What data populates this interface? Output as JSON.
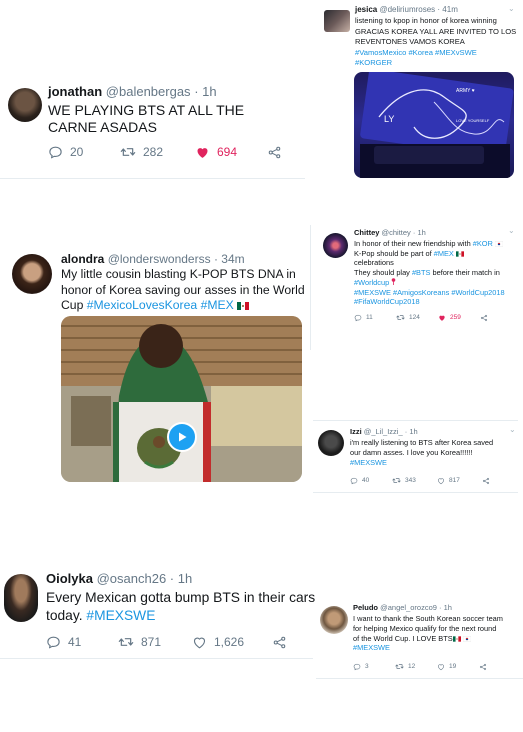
{
  "t1": {
    "name": "jonathan",
    "handle": "@balenbergas",
    "time": "· 1h",
    "text": "WE PLAYING BTS AT ALL THE CARNE ASADAS",
    "replies": "20",
    "retweets": "282",
    "likes": "694"
  },
  "t2": {
    "name": "jesica",
    "handle": "@deliriumroses",
    "time": "· 41m",
    "line1": "listening to kpop in honor of korea winning",
    "line2": "GRACIAS KOREA YALL ARE INVITED TO LOS",
    "line3": "REVENTONES VAMOS KOREA",
    "tags": "#VamosMexico #Korea #MEXvSWE",
    "tag2": "#KORGER",
    "img_text_1": "LY",
    "img_text_2": "ARMY ♥",
    "img_text_3": "LOVE YOURSELF"
  },
  "t3": {
    "name": "alondra",
    "handle": "@londerswonderss",
    "time": "· 34m",
    "line1": "My little cousin blasting K-POP BTS DNA in",
    "line2": "honor of Korea saving our asses in the World",
    "line3a": "Cup ",
    "tag1": "#MexicoLovesKorea",
    "tag2": "#MEX"
  },
  "t4": {
    "name": "Chittey",
    "handle": "@chittey",
    "time": "· 1h",
    "l1a": "In honor of their new friendship with ",
    "l1tag": "#KOR",
    "l2a": "K-Pop should be part of ",
    "l2tag": "#MEX",
    "l3": "celebrations",
    "l4a": "They should play ",
    "l4tag": "#BTS",
    "l4b": " before their match in",
    "l5": "#Worldcup",
    "l6": "#MEXSWE #AmigosKoreans #WorldCup2018",
    "l7": "#FifaWorldCup2018",
    "replies": "11",
    "retweets": "124",
    "likes": "259"
  },
  "t5": {
    "name": "Izzi",
    "handle": "@_Lil_Izzi_",
    "time": "· 1h",
    "line1": "i'm really listening to BTS after Korea saved",
    "line2": "our damn asses. I love you Korea!!!!!!",
    "tag": "#MEXSWE",
    "replies": "40",
    "retweets": "343",
    "likes": "817"
  },
  "t6": {
    "name": "Oiolyka",
    "handle": "@osanch26",
    "time": "· 1h",
    "line1": "Every Mexican gotta bump BTS in their cars",
    "line2a": "today. ",
    "tag": "#MEXSWE",
    "replies": "41",
    "retweets": "871",
    "likes": "1,626"
  },
  "t7": {
    "name": "Peludo",
    "handle": "@angel_orozco9",
    "time": "· 1h",
    "line1": "I want to thank the South Korean soccer team",
    "line2": "for helping Mexico qualify for the next round",
    "line3": "of the World Cup. I LOVE BTS",
    "tag": "#MEXSWE",
    "replies": "3",
    "retweets": "12",
    "likes": "19"
  },
  "colors": {
    "link": "#1b95e0",
    "like_active": "#e0245e",
    "meta": "#657786"
  },
  "icons": [
    "reply-icon",
    "retweet-icon",
    "like-icon",
    "share-icon",
    "play-icon",
    "chevron-down-icon",
    "mexico-flag-icon",
    "korea-flag-icon",
    "pin-icon"
  ]
}
